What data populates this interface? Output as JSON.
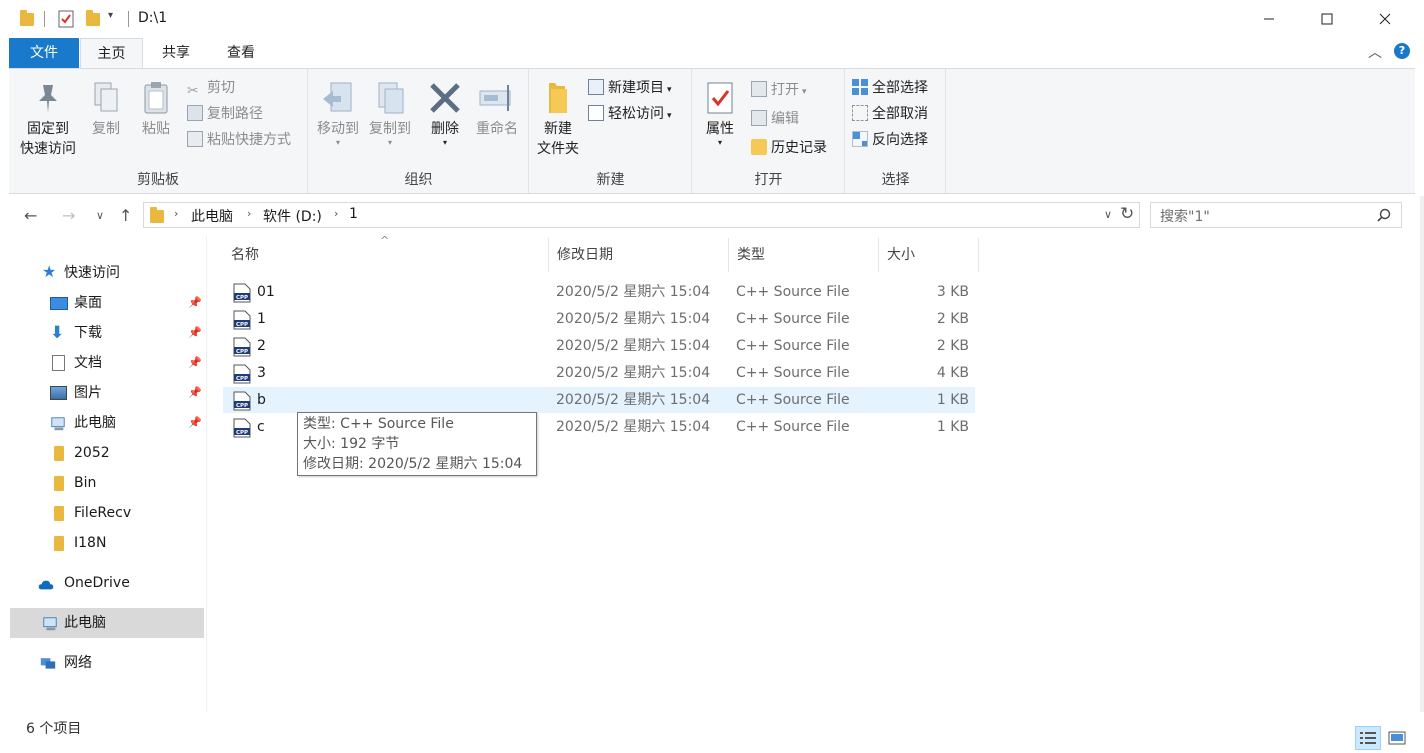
{
  "window": {
    "title": "D:\\1",
    "minimize_icon": "minimize-icon",
    "maximize_icon": "maximize-icon",
    "close_icon": "close-icon"
  },
  "ribbon_tabs": [
    "文件",
    "主页",
    "共享",
    "查看"
  ],
  "ribbon": {
    "clipboard": {
      "label": "剪贴板",
      "pin_quick_access": [
        "固定到",
        "快速访问"
      ],
      "copy": "复制",
      "paste": "粘贴",
      "cut": "剪切",
      "copy_path": "复制路径",
      "paste_shortcut": "粘贴快捷方式"
    },
    "organize": {
      "label": "组织",
      "move_to": "移动到",
      "copy_to": "复制到",
      "delete": "删除",
      "rename": "重命名"
    },
    "new": {
      "label": "新建",
      "new_folder": [
        "新建",
        "文件夹"
      ],
      "new_item": "新建项目",
      "easy_access": "轻松访问"
    },
    "open": {
      "label": "打开",
      "properties": "属性",
      "open": "打开",
      "edit": "编辑",
      "history": "历史记录"
    },
    "select": {
      "label": "选择",
      "select_all": "全部选择",
      "select_none": "全部取消",
      "invert": "反向选择"
    }
  },
  "address": {
    "breadcrumbs": [
      "此电脑",
      "软件 (D:)",
      "1"
    ],
    "search_placeholder": "搜索\"1\""
  },
  "nav": {
    "quick_access": "快速访问",
    "items": [
      {
        "label": "桌面",
        "pinned": true
      },
      {
        "label": "下载",
        "pinned": true
      },
      {
        "label": "文档",
        "pinned": true
      },
      {
        "label": "图片",
        "pinned": true
      },
      {
        "label": "此电脑",
        "pinned": true
      },
      {
        "label": "2052",
        "pinned": false
      },
      {
        "label": "Bin",
        "pinned": false
      },
      {
        "label": "FileRecv",
        "pinned": false
      },
      {
        "label": "I18N",
        "pinned": false
      }
    ],
    "onedrive": "OneDrive",
    "this_pc": "此电脑",
    "network": "网络"
  },
  "columns": [
    "名称",
    "修改日期",
    "类型",
    "大小"
  ],
  "files": [
    {
      "name": "01",
      "date": "2020/5/2 星期六 15:04",
      "type": "C++ Source File",
      "size": "3 KB"
    },
    {
      "name": "1",
      "date": "2020/5/2 星期六 15:04",
      "type": "C++ Source File",
      "size": "2 KB"
    },
    {
      "name": "2",
      "date": "2020/5/2 星期六 15:04",
      "type": "C++ Source File",
      "size": "2 KB"
    },
    {
      "name": "3",
      "date": "2020/5/2 星期六 15:04",
      "type": "C++ Source File",
      "size": "4 KB"
    },
    {
      "name": "b",
      "date": "2020/5/2 星期六 15:04",
      "type": "C++ Source File",
      "size": "1 KB"
    },
    {
      "name": "c",
      "date": "2020/5/2 星期六 15:04",
      "type": "C++ Source File",
      "size": "1 KB"
    }
  ],
  "tooltip": {
    "type": "类型: C++ Source File",
    "size": "大小: 192 字节",
    "date": "修改日期: 2020/5/2 星期六 15:04"
  },
  "status": {
    "item_count": "6 个项目"
  },
  "colors": {
    "accent": "#1979ca",
    "folder": "#e8b93e",
    "selection": "#e5f3ff"
  }
}
